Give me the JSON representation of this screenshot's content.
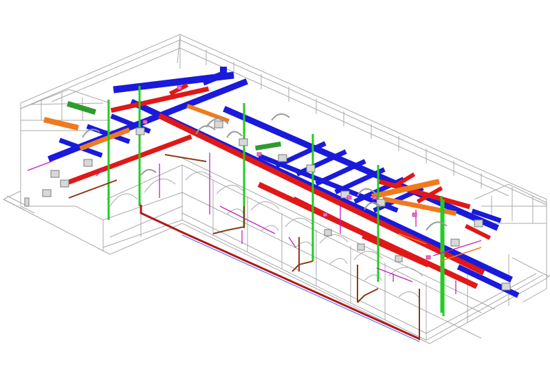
{
  "view": {
    "type": "isometric-bim-mep-model",
    "labels_visible": false
  },
  "colors": {
    "background": "#ffffff",
    "building_outline": "#a8a8a8",
    "supply_duct": "#1a1adb",
    "return_duct": "#e01818",
    "exhaust_duct": "#f07a1e",
    "vertical_riser": "#22cc22",
    "fresh_air_duct": "#2f9a2f",
    "piping_magenta": "#c020c0",
    "piping_brown": "#8a3a10",
    "equipment": "#d8d8d8",
    "accent_pink": "#ff66cc"
  },
  "systems": [
    {
      "id": "supply",
      "color_key": "supply_duct"
    },
    {
      "id": "return",
      "color_key": "return_duct"
    },
    {
      "id": "exhaust",
      "color_key": "exhaust_duct"
    },
    {
      "id": "risers",
      "color_key": "vertical_riser"
    },
    {
      "id": "fresh-air",
      "color_key": "fresh_air_duct"
    },
    {
      "id": "piping",
      "color_key": "piping_magenta"
    },
    {
      "id": "drain",
      "color_key": "piping_brown"
    }
  ]
}
